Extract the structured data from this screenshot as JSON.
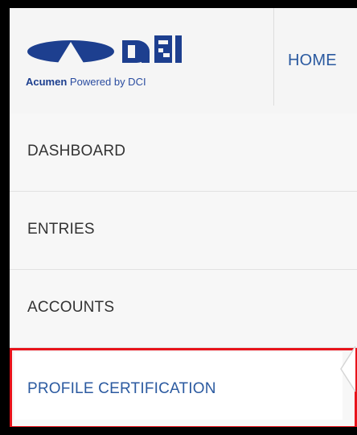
{
  "logo": {
    "brand_name": "Acumen",
    "powered_by_text": "Powered by DCI",
    "mark_text": "DCI"
  },
  "nav": {
    "home_label": "HOME"
  },
  "menu": {
    "items": [
      {
        "label": "DASHBOARD"
      },
      {
        "label": "ENTRIES"
      },
      {
        "label": "ACCOUNTS"
      },
      {
        "label": "PROFILE CERTIFICATION"
      }
    ]
  },
  "colors": {
    "brand_blue": "#1d3f8f",
    "link_blue": "#2b5aa0",
    "highlight_red": "#e8131b",
    "menu_text": "#333333"
  }
}
